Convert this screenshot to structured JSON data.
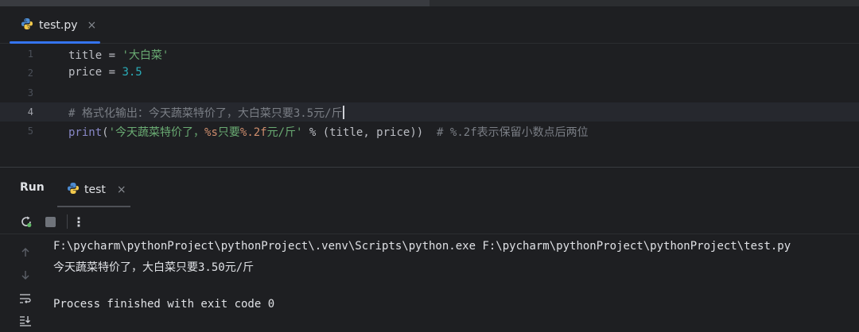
{
  "editor": {
    "tab": {
      "filename": "test.py",
      "close": "×",
      "icon": "python-icon"
    },
    "line_numbers": [
      "1",
      "2",
      "3",
      "4",
      "5"
    ],
    "lines": [
      {
        "parts": [
          "title = ",
          "'大白菜'"
        ]
      },
      {
        "parts": [
          "price = ",
          "3.5"
        ]
      },
      {
        "parts": []
      },
      {
        "parts": [
          "# 格式化输出：今天蔬菜特价了，大白菜只要3.5元/斤"
        ]
      },
      {
        "parts": [
          "print",
          "(",
          "'今天蔬菜特价了，",
          "%s",
          "只要",
          "%.2f",
          "元/斤'",
          " % (title, price))  ",
          "# %.2f表示保留小数点后两位"
        ]
      }
    ]
  },
  "run_panel": {
    "title": "Run",
    "tab_label": "test",
    "tab_close": "×",
    "toolbar": {
      "rerun": "rerun-icon",
      "stop": "stop-icon",
      "more": "⋮"
    },
    "console": [
      "F:\\pycharm\\pythonProject\\pythonProject\\.venv\\Scripts\\python.exe F:\\pycharm\\pythonProject\\pythonProject\\test.py",
      "今天蔬菜特价了，大白菜只要3.50元/斤",
      "",
      "Process finished with exit code 0"
    ]
  },
  "colors": {
    "background": "#1e1f22",
    "accent": "#3574f0",
    "string": "#6aab73",
    "number": "#2aacb8",
    "keyword": "#cf8e6d",
    "comment": "#7a7e85"
  }
}
